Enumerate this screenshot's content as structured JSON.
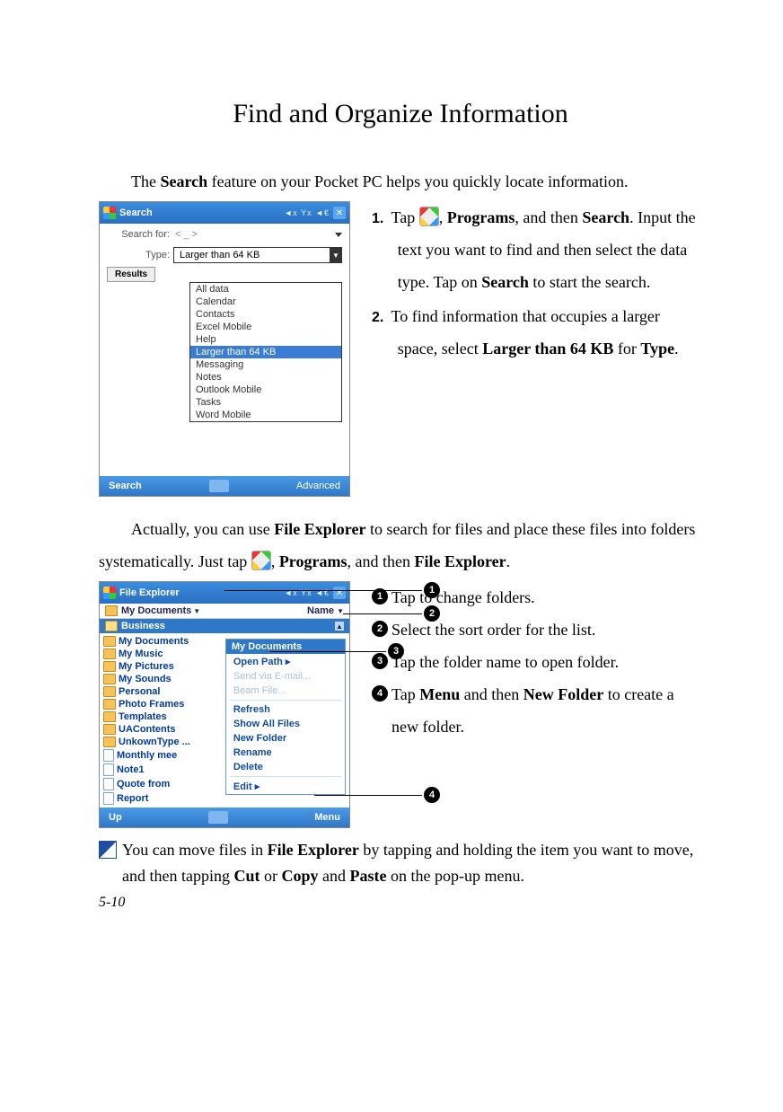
{
  "title": "Find and Organize Information",
  "intro_1": "The ",
  "intro_bold_search": "Search",
  "intro_2": " feature on your Pocket PC helps you quickly locate information.",
  "shot1": {
    "titlebar": "Search",
    "sys": "◄x  Yx ◄€",
    "search_for_label": "Search for:",
    "search_for_value": "<  _  >",
    "type_label": "Type:",
    "type_value": "Larger than 64 KB",
    "results_label": "Results",
    "options": [
      "All data",
      "Calendar",
      "Contacts",
      "Excel Mobile",
      "Help",
      "Larger than 64 KB",
      "Messaging",
      "Notes",
      "Outlook Mobile",
      "Tasks",
      "Word Mobile"
    ],
    "selected_option_index": 5,
    "bottom_left": "Search",
    "bottom_right": "Advanced"
  },
  "steps": {
    "s1a": "Tap ",
    "s1b": ", ",
    "s1_programs": "Programs",
    "s1c": ", and then ",
    "s1_search": "Search",
    "s1d": ". Input the text you want to find and then select the data type. Tap on ",
    "s1_search2": "Search",
    "s1e": " to start the search.",
    "s2a": "To find information that occupies a larger space, select ",
    "s2_bold": "Larger than 64 KB",
    "s2b": " for ",
    "s2_type": "Type",
    "s2c": "."
  },
  "para2": {
    "a": "Actually, you can use ",
    "fe": "File Explorer",
    "b": " to search for files and place these files into folders systematically. Just tap ",
    "c": ", ",
    "programs": "Programs",
    "d": ", and then ",
    "fe2": "File Explorer",
    "e": "."
  },
  "shot2": {
    "titlebar": "File Explorer",
    "folder": "My Documents",
    "sort": "Name",
    "business": "Business",
    "left_items": [
      "My Documents",
      "My Music",
      "My Pictures",
      "My Sounds",
      "Personal",
      "Photo Frames",
      "Templates",
      "UAContents",
      "UnkownType ...",
      "Monthly mee",
      "Note1",
      "Quote from",
      "Report"
    ],
    "ctx_header": "My Documents",
    "ctx_items": [
      "Open Path",
      "Send via E-mail...",
      "Beam File...",
      "Refresh",
      "Show All Files",
      "New Folder",
      "Rename",
      "Delete",
      "Edit"
    ],
    "ctx_disabled": [
      1,
      2
    ],
    "bottom_left": "Up",
    "bottom_right": "Menu"
  },
  "annotations": {
    "a1": "Tap to change folders.",
    "a2": "Select the sort order for the list.",
    "a3": "Tap the folder name to open folder.",
    "a4a": "Tap ",
    "a4_menu": "Menu",
    "a4b": " and then ",
    "a4_new": "New Folder",
    "a4c": " to create a new folder."
  },
  "note": {
    "a": "You can move files in ",
    "fe": "File Explorer",
    "b": " by tapping and holding the item you want to move, and then tapping ",
    "cut": "Cut",
    "c": " or ",
    "copy": "Copy",
    "d": " and ",
    "paste": "Paste",
    "e": " on the pop-up menu."
  },
  "page_number": "5-10"
}
